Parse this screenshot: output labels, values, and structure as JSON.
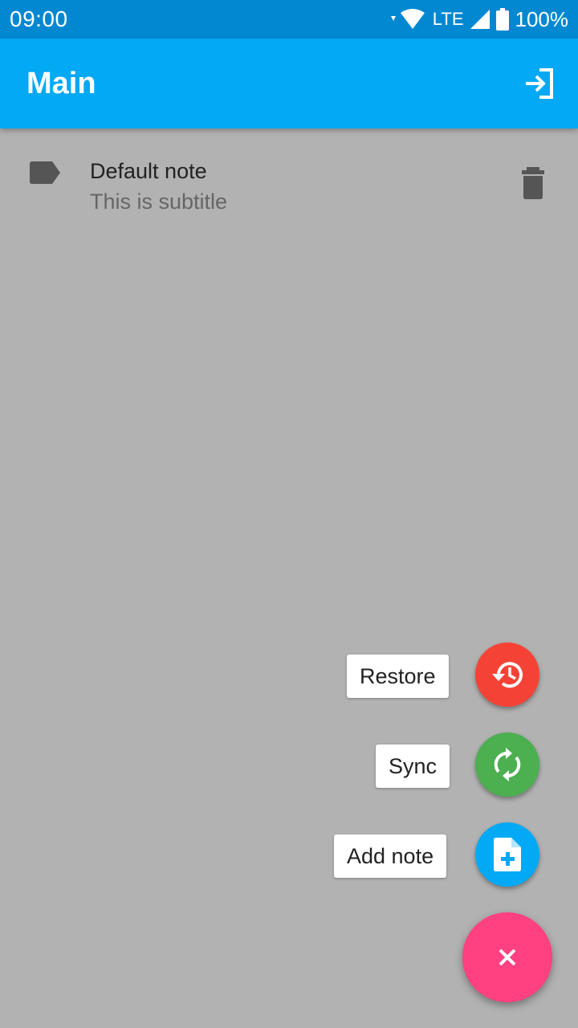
{
  "status_bar": {
    "time": "09:00",
    "network": "LTE",
    "battery": "100%",
    "icons": [
      "wifi-icon",
      "signal-icon",
      "battery-icon"
    ]
  },
  "app_bar": {
    "title": "Main",
    "action_icon": "login-icon"
  },
  "notes": [
    {
      "title": "Default note",
      "subtitle": "This is subtitle",
      "icon": "label-icon",
      "action_icon": "delete-icon"
    }
  ],
  "speed_dial": {
    "actions": [
      {
        "label": "Restore",
        "icon": "restore-icon",
        "color": "#f44336"
      },
      {
        "label": "Sync",
        "icon": "sync-icon",
        "color": "#4caf50"
      },
      {
        "label": "Add note",
        "icon": "add-note-icon",
        "color": "#03a9f4"
      }
    ],
    "close_icon": "close-icon",
    "fab_color": "#ff4081"
  },
  "colors": {
    "status_bar": "#0288d1",
    "app_bar": "#03a9f4",
    "scrim": "#b2b2b2"
  }
}
